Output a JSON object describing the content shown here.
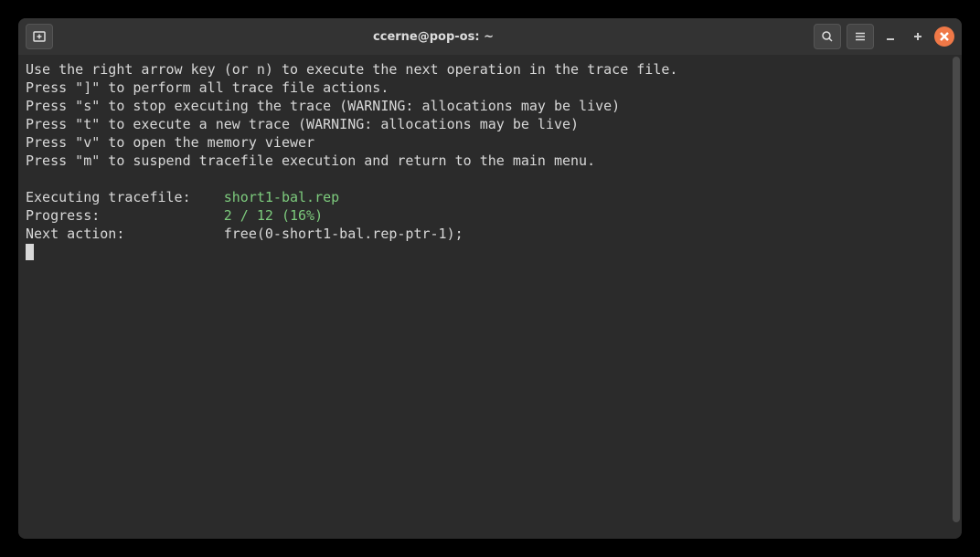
{
  "titlebar": {
    "title": "ccerne@pop-os: ~"
  },
  "terminal": {
    "help_lines": [
      "Use the right arrow key (or n) to execute the next operation in the trace file.",
      "Press \"]\" to perform all trace file actions.",
      "Press \"s\" to stop executing the trace (WARNING: allocations may be live)",
      "Press \"t\" to execute a new trace (WARNING: allocations may be live)",
      "Press \"v\" to open the memory viewer",
      "Press \"m\" to suspend tracefile execution and return to the main menu."
    ],
    "tracefile_label": "Executing tracefile:    ",
    "tracefile_value": "short1-bal.rep",
    "progress_label": "Progress:               ",
    "progress_value": "2 / 12 (16%)",
    "next_action_label": "Next action:            ",
    "next_action_value": "free(0-short1-bal.rep-ptr-1);"
  }
}
